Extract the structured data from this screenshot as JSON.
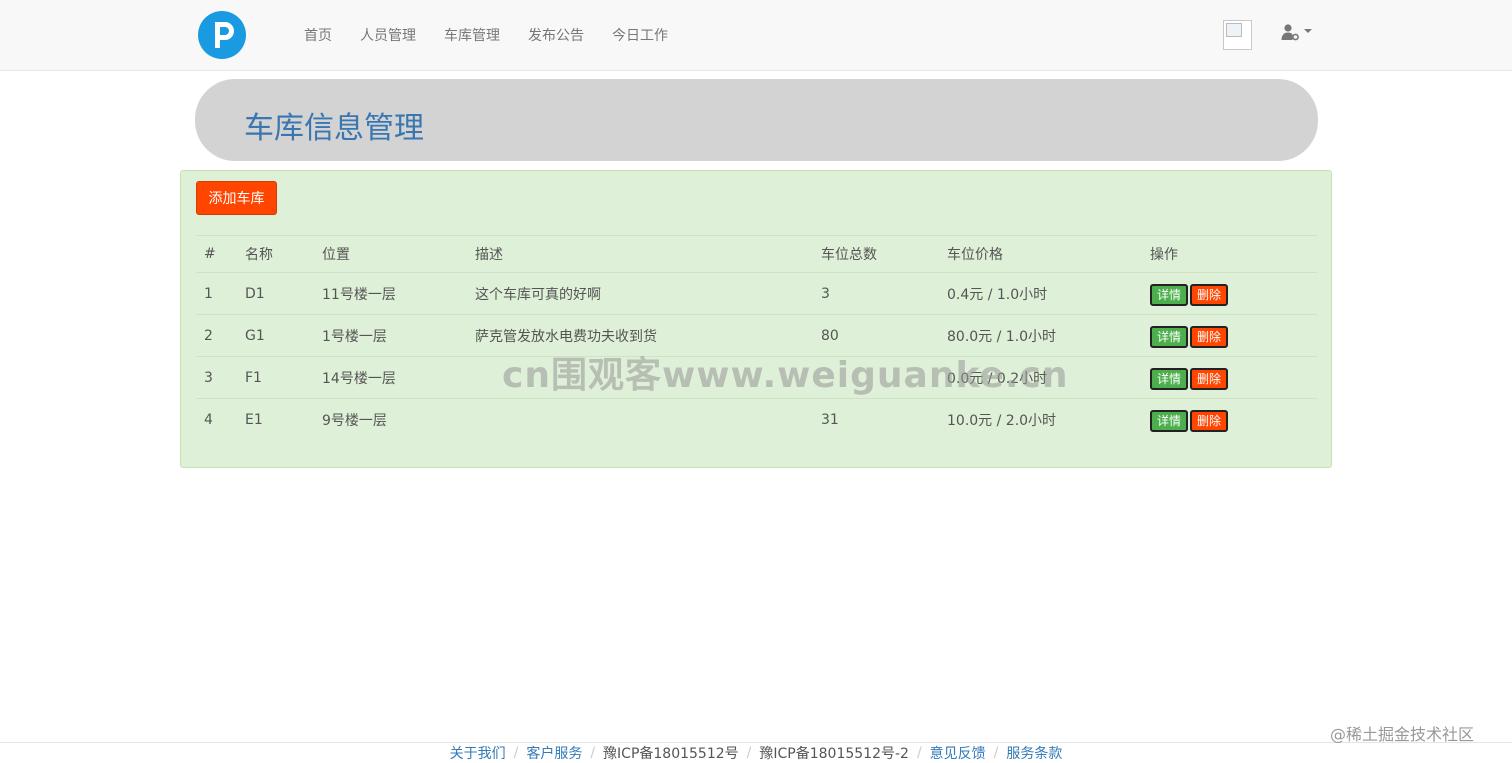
{
  "nav": {
    "items": [
      "首页",
      "人员管理",
      "车库管理",
      "发布公告",
      "今日工作"
    ]
  },
  "page": {
    "title": "车库信息管理",
    "add_button": "添加车库"
  },
  "table": {
    "headers": [
      "#",
      "名称",
      "位置",
      "描述",
      "车位总数",
      "车位价格",
      "操作"
    ],
    "rows": [
      [
        "1",
        "D1",
        "11号楼一层",
        "这个车库可真的好啊",
        "3",
        "0.4元 / 1.0小时"
      ],
      [
        "2",
        "G1",
        "1号楼一层",
        "萨克管发放水电费功夫收到货",
        "80",
        "80.0元 / 1.0小时"
      ],
      [
        "3",
        "F1",
        "14号楼一层",
        "",
        "",
        "0.0元 / 0.2小时"
      ],
      [
        "4",
        "E1",
        "9号楼一层",
        "",
        "31",
        "10.0元 / 2.0小时"
      ]
    ],
    "detail_label": "详情",
    "delete_label": "删除"
  },
  "watermark": "cn围观客www.weiguanke.cn",
  "footer": {
    "about": "关于我们",
    "service": "客户服务",
    "icp1": "豫ICP备18015512号",
    "icp2": "豫ICP备18015512号-2",
    "feedback": "意见反馈",
    "terms": "服务条款"
  },
  "corner_mark": "@稀土掘金技术社区",
  "colors": {
    "accent": "#ff4500",
    "success": "#4cae4c",
    "panel_bg": "#dff0d8",
    "title": "#3a76b0",
    "logo": "#1a9ae0"
  },
  "icons": {
    "logo": "parking-p-logo",
    "user": "user-settings-icon"
  }
}
